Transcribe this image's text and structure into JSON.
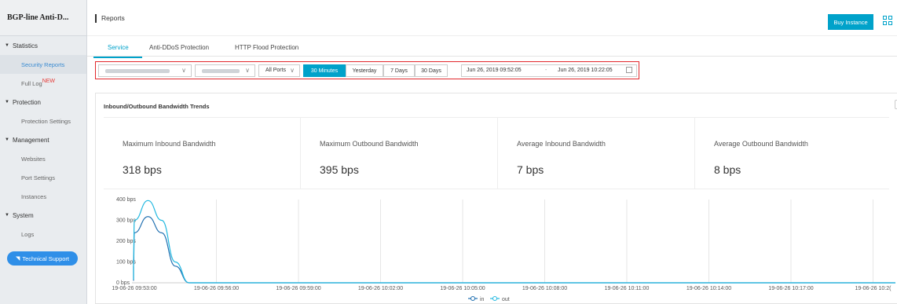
{
  "sidebar": {
    "title": "BGP-line Anti-D...",
    "groups": [
      {
        "label": "Statistics",
        "items": [
          {
            "label": "Security Reports"
          },
          {
            "label": "Full Log",
            "badge": "NEW"
          }
        ]
      },
      {
        "label": "Protection",
        "items": [
          {
            "label": "Protection Settings"
          }
        ]
      },
      {
        "label": "Management",
        "items": [
          {
            "label": "Websites"
          },
          {
            "label": "Port Settings"
          },
          {
            "label": "Instances"
          }
        ]
      },
      {
        "label": "System",
        "items": [
          {
            "label": "Logs"
          }
        ]
      }
    ],
    "support_button": "Technical Support"
  },
  "header": {
    "title": "Reports",
    "buy_button": "Buy Instance"
  },
  "tabs": [
    {
      "label": "Service",
      "active": true
    },
    {
      "label": "Anti-DDoS Protection",
      "active": false
    },
    {
      "label": "HTTP Flood Protection",
      "active": false
    }
  ],
  "filters": {
    "port_select": "All Ports",
    "ranges": [
      {
        "label": "30 Minutes",
        "active": true
      },
      {
        "label": "Yesterday",
        "active": false
      },
      {
        "label": "7 Days",
        "active": false
      },
      {
        "label": "30 Days",
        "active": false
      }
    ],
    "start_time": "Jun 26, 2019 09:52:05",
    "separator": "-",
    "end_time": "Jun 26, 2019 10:22:05"
  },
  "card": {
    "title": "Inbound/Outbound Bandwidth Trends",
    "stats": [
      {
        "label": "Maximum Inbound Bandwidth",
        "value": "318 bps"
      },
      {
        "label": "Maximum Outbound Bandwidth",
        "value": "395 bps"
      },
      {
        "label": "Average Inbound Bandwidth",
        "value": "7 bps"
      },
      {
        "label": "Average Outbound Bandwidth",
        "value": "8 bps"
      }
    ]
  },
  "colors": {
    "accent": "#00a2ca",
    "sidebar_active_text": "#3a8bd1",
    "highlight_border": "#e2282c",
    "in_line": "#1f6fb0",
    "out_line": "#22b8e0"
  },
  "chart_data": {
    "type": "line",
    "y_ticks": [
      "400 bps",
      "300 bps",
      "200 bps",
      "100 bps",
      "0 bps"
    ],
    "ylim": [
      0,
      400
    ],
    "x_ticks": [
      "19-06-26 09:53:00",
      "19-06-26 09:56:00",
      "19-06-26 09:59:00",
      "19-06-26 10:02:00",
      "19-06-26 10:05:00",
      "19-06-26 10:08:00",
      "19-06-26 10:11:00",
      "19-06-26 10:14:00",
      "19-06-26 10:17:00",
      "19-06-26 10:2("
    ],
    "x": [
      "09:52:05",
      "09:52:30",
      "09:53:00",
      "09:53:30",
      "09:54:00",
      "09:54:30",
      "09:55:00",
      "09:56:00",
      "10:22:05"
    ],
    "series": [
      {
        "name": "in",
        "values": [
          10,
          80,
          240,
          318,
          240,
          80,
          0,
          0,
          0
        ]
      },
      {
        "name": "out",
        "values": [
          15,
          110,
          300,
          395,
          300,
          100,
          0,
          0,
          0
        ]
      }
    ],
    "legend": [
      "in",
      "out"
    ],
    "legend_position": "bottom",
    "grid": true
  }
}
